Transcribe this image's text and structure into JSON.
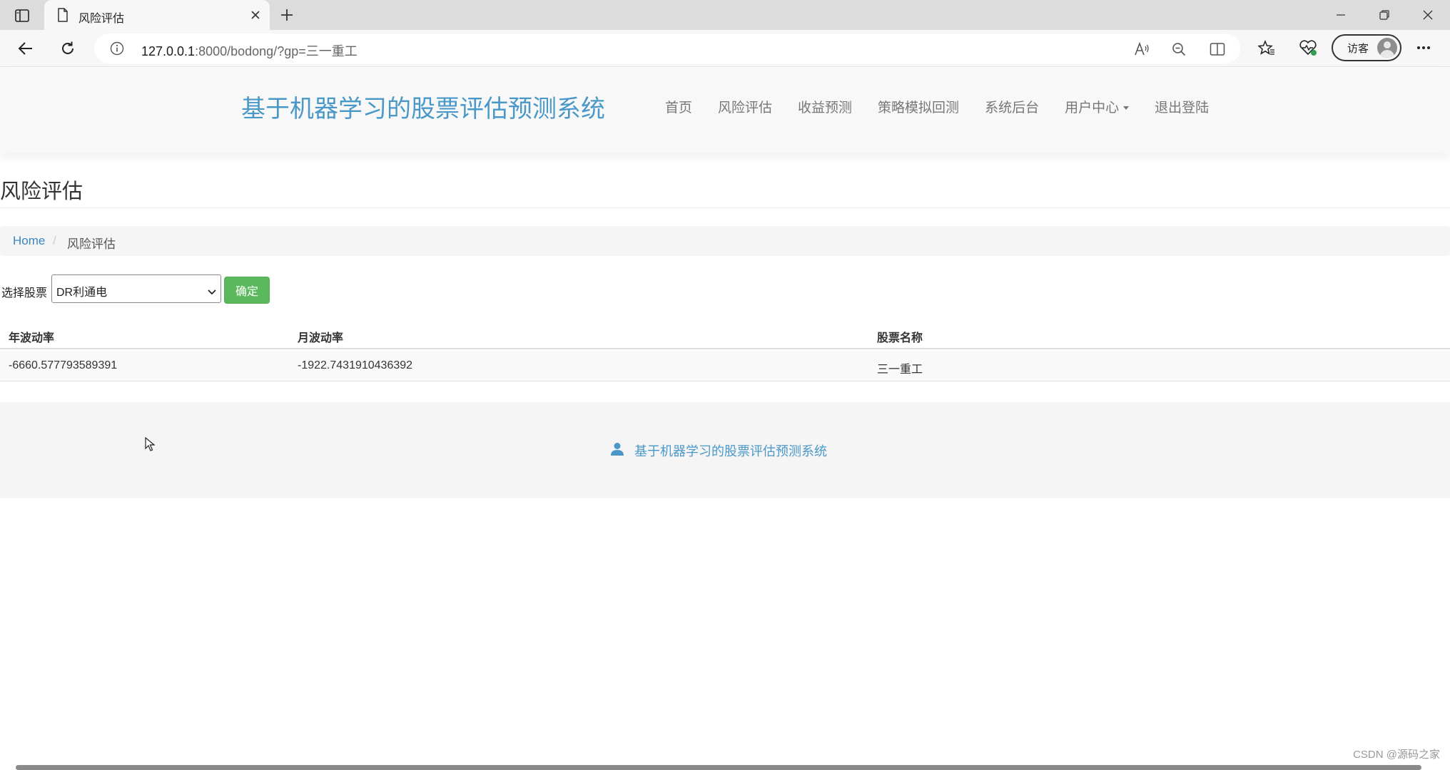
{
  "browser": {
    "tab_title": "风险评估",
    "url_host": "127.0.0.1",
    "url_rest": ":8000/bodong/?gp=三一重工",
    "guest_label": "访客"
  },
  "site": {
    "brand": "基于机器学习的股票评估预测系统",
    "nav": {
      "home": "首页",
      "risk": "风险评估",
      "profit": "收益预测",
      "strategy": "策略模拟回测",
      "admin": "系统后台",
      "user_center": "用户中心",
      "logout": "退出登陆"
    }
  },
  "page": {
    "heading": "风险评估",
    "breadcrumb": {
      "home": "Home",
      "separator": "/",
      "current": "风险评估"
    },
    "selector": {
      "label": "选择股票",
      "selected": "DR利通电",
      "confirm": "确定"
    },
    "table": {
      "headers": [
        "年波动率",
        "月波动率",
        "股票名称"
      ],
      "rows": [
        [
          "-6660.577793589391",
          "-1922.7431910436392",
          "三一重工"
        ]
      ]
    },
    "footer": "基于机器学习的股票评估预测系统"
  },
  "watermark": "CSDN @源码之家",
  "colors": {
    "brand": "#4a98c8",
    "confirm_button": "#5cb85c",
    "link": "#3a86c4"
  }
}
